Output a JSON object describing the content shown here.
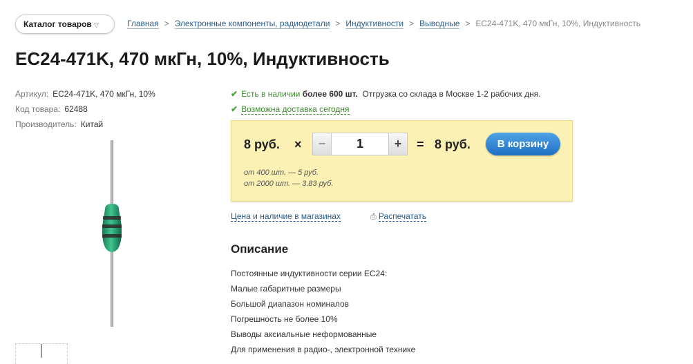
{
  "header": {
    "catalog_button": "Каталог товаров",
    "breadcrumb": [
      "Главная",
      "Электронные компоненты, радиодетали",
      "Индуктивности",
      "Выводные"
    ],
    "breadcrumb_current": "EC24-471K, 470 мкГн, 10%, Индуктивность"
  },
  "product": {
    "title": "EC24-471K, 470 мкГн, 10%, Индуктивность",
    "meta": [
      {
        "label": "Артикул:",
        "value": "EC24-471K, 470 мкГн, 10%"
      },
      {
        "label": "Код товара:",
        "value": "62488"
      },
      {
        "label": "Производитель:",
        "value": "Китай"
      }
    ]
  },
  "availability": {
    "stock_prefix": "Есть в наличии",
    "stock_amount": "более 600 шт.",
    "shipping": "Отгрузка со склада в Москве 1-2 рабочих дня.",
    "delivery": "Возможна доставка сегодня"
  },
  "price_box": {
    "unit_price": "8 руб.",
    "multiply": "×",
    "quantity": "1",
    "minus": "−",
    "plus": "+",
    "equals": "=",
    "total": "8 руб.",
    "cart_button": "В корзину",
    "tiers": [
      "от 400 шт. — 5 руб.",
      "от 2000 шт. — 3.83 руб."
    ]
  },
  "links": {
    "stores": "Цена и наличие в магазинах",
    "print": "Распечатать"
  },
  "description": {
    "title": "Описание",
    "lines": [
      "Постоянные индуктивности серии EC24:",
      "Малые габаритные размеры",
      "Большой диапазон номиналов",
      "Погрешность не более 10%",
      "Выводы аксиальные неформованные",
      "Для применения в радио-, электронной технике"
    ]
  },
  "icons": {
    "check": "check-icon",
    "print": "printer-icon",
    "dropdown": "chevron-down-icon"
  },
  "colors": {
    "link": "#2a5c8a",
    "in_stock": "#3d8a2f",
    "price_box_bg": "#fbf1b4",
    "cart_button": "#2a7fd4"
  }
}
